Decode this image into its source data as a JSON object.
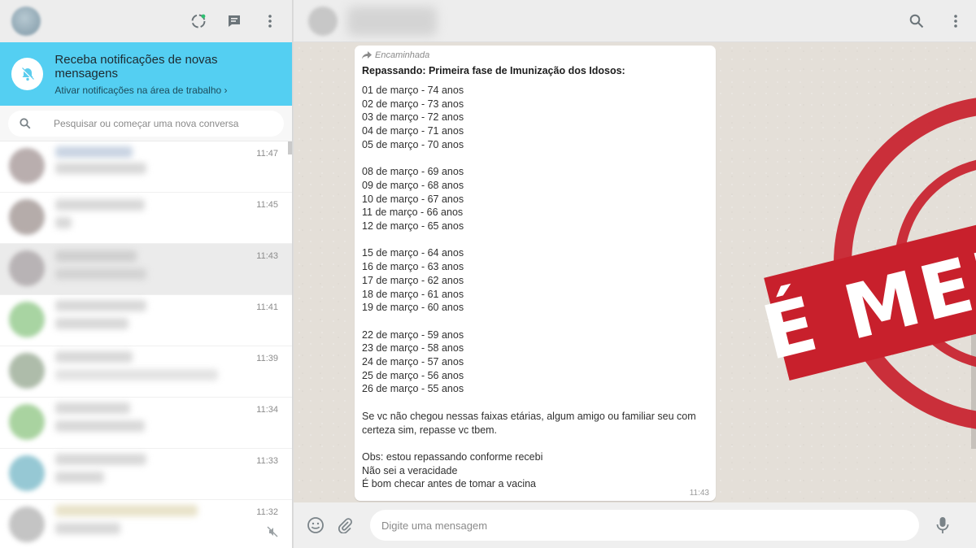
{
  "sidebar": {
    "notification": {
      "title": "Receba notificações de novas mensagens",
      "subtitle": "Ativar notificações na área de trabalho ›"
    },
    "search": {
      "placeholder": "Pesquisar ou começar uma nova conversa"
    },
    "chats": [
      {
        "time": "11:47"
      },
      {
        "time": "11:45"
      },
      {
        "time": "11:43"
      },
      {
        "time": "11:41"
      },
      {
        "time": "11:39"
      },
      {
        "time": "11:34"
      },
      {
        "time": "11:33"
      },
      {
        "time": "11:32"
      }
    ]
  },
  "message": {
    "forwarded_label": "Encaminhada",
    "title": "Repassando: Primeira fase de Imunização dos Idosos:",
    "lines": [
      "01 de março - 74 anos",
      "02 de março - 73 anos",
      "03 de março - 72 anos",
      "04 de março - 71 anos",
      "05 de março - 70 anos",
      "",
      "08 de março - 69 anos",
      "09 de março - 68 anos",
      "10 de março - 67 anos",
      "11 de março - 66 anos",
      "12 de março - 65 anos",
      "",
      "15 de março - 64 anos",
      "16 de março - 63 anos",
      "17 de março - 62 anos",
      "18 de março - 61 anos",
      "19 de março - 60 anos",
      "",
      "22 de março - 59 anos",
      "23 de março - 58 anos",
      "24 de março - 57 anos",
      "25 de março - 56 anos",
      "26 de março - 55 anos",
      "",
      "Se vc não chegou nessas faixas etárias, algum amigo ou familiar seu com",
      "certeza sim, repasse vc tbem.",
      "",
      "Obs: estou repassando conforme recebi",
      "Não sei a veracidade",
      "É bom checar antes de tomar a vacina"
    ],
    "time": "11:43"
  },
  "stamp": {
    "text": "É MENTIRA",
    "color": "#c8202c"
  },
  "composer": {
    "placeholder": "Digite uma mensagem"
  },
  "colors": {
    "notification_bar": "#54cff2",
    "header": "#ededed",
    "wallpaper": "#e4dfd8"
  }
}
